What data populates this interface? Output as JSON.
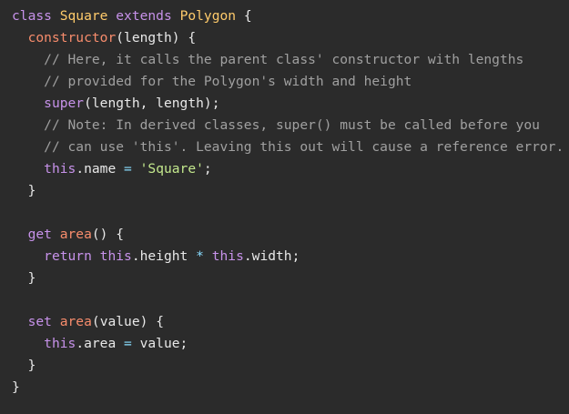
{
  "editor": {
    "background": "#2b2b2b",
    "colors": {
      "keyword": "#c792ea",
      "class_name": "#ffcb6b",
      "function_name": "#f78c6c",
      "comment": "#a0a0a0",
      "string": "#c3e88d",
      "operator": "#89ddff",
      "text": "#e8e8e8"
    },
    "lines": [
      [
        [
          "kw",
          "class"
        ],
        [
          "plain",
          " "
        ],
        [
          "cls",
          "Square"
        ],
        [
          "plain",
          " "
        ],
        [
          "kw",
          "extends"
        ],
        [
          "plain",
          " "
        ],
        [
          "cls",
          "Polygon"
        ],
        [
          "punct",
          " {"
        ]
      ],
      [
        [
          "plain",
          "  "
        ],
        [
          "fn",
          "constructor"
        ],
        [
          "punct",
          "("
        ],
        [
          "param",
          "length"
        ],
        [
          "punct",
          ") {"
        ]
      ],
      [
        [
          "plain",
          "    "
        ],
        [
          "comment",
          "// Here, it calls the parent class' constructor with lengths"
        ]
      ],
      [
        [
          "plain",
          "    "
        ],
        [
          "comment",
          "// provided for the Polygon's width and height"
        ]
      ],
      [
        [
          "plain",
          "    "
        ],
        [
          "thiskw",
          "super"
        ],
        [
          "punct",
          "("
        ],
        [
          "plain",
          "length, length"
        ],
        [
          "punct",
          ");"
        ]
      ],
      [
        [
          "plain",
          "    "
        ],
        [
          "comment",
          "// Note: In derived classes, super() must be called before you"
        ]
      ],
      [
        [
          "plain",
          "    "
        ],
        [
          "comment",
          "// can use 'this'. Leaving this out will cause a reference error."
        ]
      ],
      [
        [
          "plain",
          "    "
        ],
        [
          "thiskw",
          "this"
        ],
        [
          "plain",
          ".name "
        ],
        [
          "op",
          "="
        ],
        [
          "plain",
          " "
        ],
        [
          "str",
          "'Square'"
        ],
        [
          "punct",
          ";"
        ]
      ],
      [
        [
          "plain",
          "  "
        ],
        [
          "punct",
          "}"
        ]
      ],
      [
        [
          "plain",
          ""
        ]
      ],
      [
        [
          "plain",
          "  "
        ],
        [
          "kw",
          "get"
        ],
        [
          "plain",
          " "
        ],
        [
          "fn",
          "area"
        ],
        [
          "punct",
          "() {"
        ]
      ],
      [
        [
          "plain",
          "    "
        ],
        [
          "kw",
          "return"
        ],
        [
          "plain",
          " "
        ],
        [
          "thiskw",
          "this"
        ],
        [
          "plain",
          ".height "
        ],
        [
          "op",
          "*"
        ],
        [
          "plain",
          " "
        ],
        [
          "thiskw",
          "this"
        ],
        [
          "plain",
          ".width"
        ],
        [
          "punct",
          ";"
        ]
      ],
      [
        [
          "plain",
          "  "
        ],
        [
          "punct",
          "}"
        ]
      ],
      [
        [
          "plain",
          ""
        ]
      ],
      [
        [
          "plain",
          "  "
        ],
        [
          "kw",
          "set"
        ],
        [
          "plain",
          " "
        ],
        [
          "fn",
          "area"
        ],
        [
          "punct",
          "("
        ],
        [
          "param",
          "value"
        ],
        [
          "punct",
          ") {"
        ]
      ],
      [
        [
          "plain",
          "    "
        ],
        [
          "thiskw",
          "this"
        ],
        [
          "plain",
          ".area "
        ],
        [
          "op",
          "="
        ],
        [
          "plain",
          " value"
        ],
        [
          "punct",
          ";"
        ]
      ],
      [
        [
          "plain",
          "  "
        ],
        [
          "punct",
          "}"
        ]
      ],
      [
        [
          "punct",
          "}"
        ]
      ]
    ]
  }
}
